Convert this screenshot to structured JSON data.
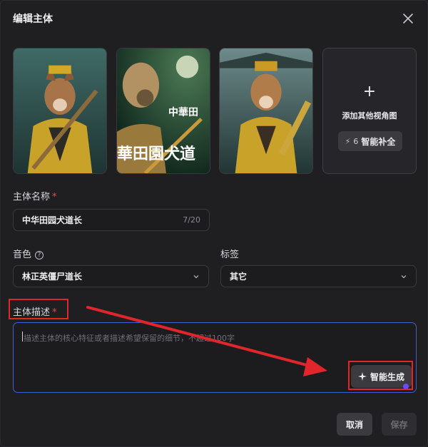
{
  "dialog": {
    "title": "编辑主体"
  },
  "thumbnails": [
    {
      "caption": ""
    },
    {
      "caption_top": "中華田",
      "caption_bottom": "華田園犬道"
    },
    {
      "caption": ""
    }
  ],
  "add_view": {
    "plus": "+",
    "label": "添加其他视角图",
    "smart_count": "6",
    "smart_label": "智能补全"
  },
  "name_field": {
    "label": "主体名称",
    "required_mark": "*",
    "value": "中华田园犬道长",
    "counter": "7/20"
  },
  "voice_field": {
    "label": "音色",
    "help": "?",
    "value": "林正英僵尸道长"
  },
  "tag_field": {
    "label": "标签",
    "value": "其它"
  },
  "desc_field": {
    "label": "主体描述",
    "required_mark": "*",
    "placeholder": "描述主体的核心特征或者描述希望保留的细节，不超过100字"
  },
  "generate_button": {
    "label": "智能生成"
  },
  "footer": {
    "cancel_label": "取消",
    "save_label": "保存"
  },
  "colors": {
    "accent_border": "#3d5fd6",
    "annotation_red": "#e0262b",
    "required": "#e84a4a",
    "dot": "#6a4cf5"
  },
  "icons": [
    "close-icon",
    "plus-icon",
    "bolt-icon",
    "help-icon",
    "chevron-down-icon",
    "sparkle-icon"
  ]
}
